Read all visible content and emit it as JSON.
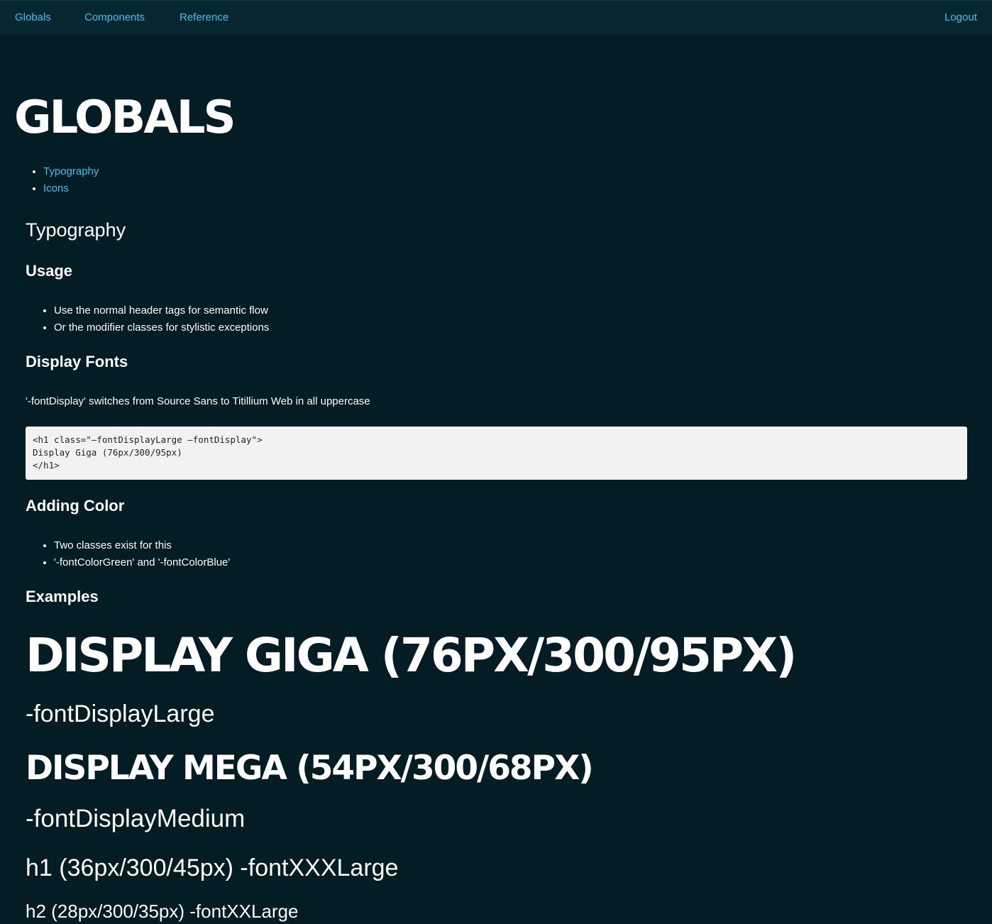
{
  "nav": {
    "items": [
      {
        "label": "Globals"
      },
      {
        "label": "Components"
      },
      {
        "label": "Reference"
      }
    ],
    "logout": "Logout"
  },
  "page": {
    "title": "Globals",
    "toc": [
      {
        "label": "Typography"
      },
      {
        "label": "Icons"
      }
    ]
  },
  "typography": {
    "title": "Typography",
    "usage": {
      "heading": "Usage",
      "items": [
        "Use the normal header tags for semantic flow",
        "Or the modifier classes for stylistic exceptions"
      ]
    },
    "display_fonts": {
      "heading": "Display Fonts",
      "description": "'-fontDisplay' switches from Source Sans to Titillium Web in all uppercase",
      "code": "<h1 class=\"–fontDisplayLarge –fontDisplay\">\nDisplay Giga (76px/300/95px)\n</h1>"
    },
    "adding_color": {
      "heading": "Adding Color",
      "items": [
        "Two classes exist for this",
        "'-fontColorGreen' and '-fontColorBlue'"
      ]
    },
    "examples": {
      "heading": "Examples",
      "display_giga": "Display Giga (76px/300/95px)",
      "display_large_label": "-fontDisplayLarge",
      "display_mega": "Display Mega (54px/300/68px)",
      "display_medium_label": "-fontDisplayMedium",
      "h1_example": "h1 (36px/300/45px) -fontXXXLarge",
      "h2_example": "h2 (28px/300/35px) -fontXXLarge"
    }
  }
}
